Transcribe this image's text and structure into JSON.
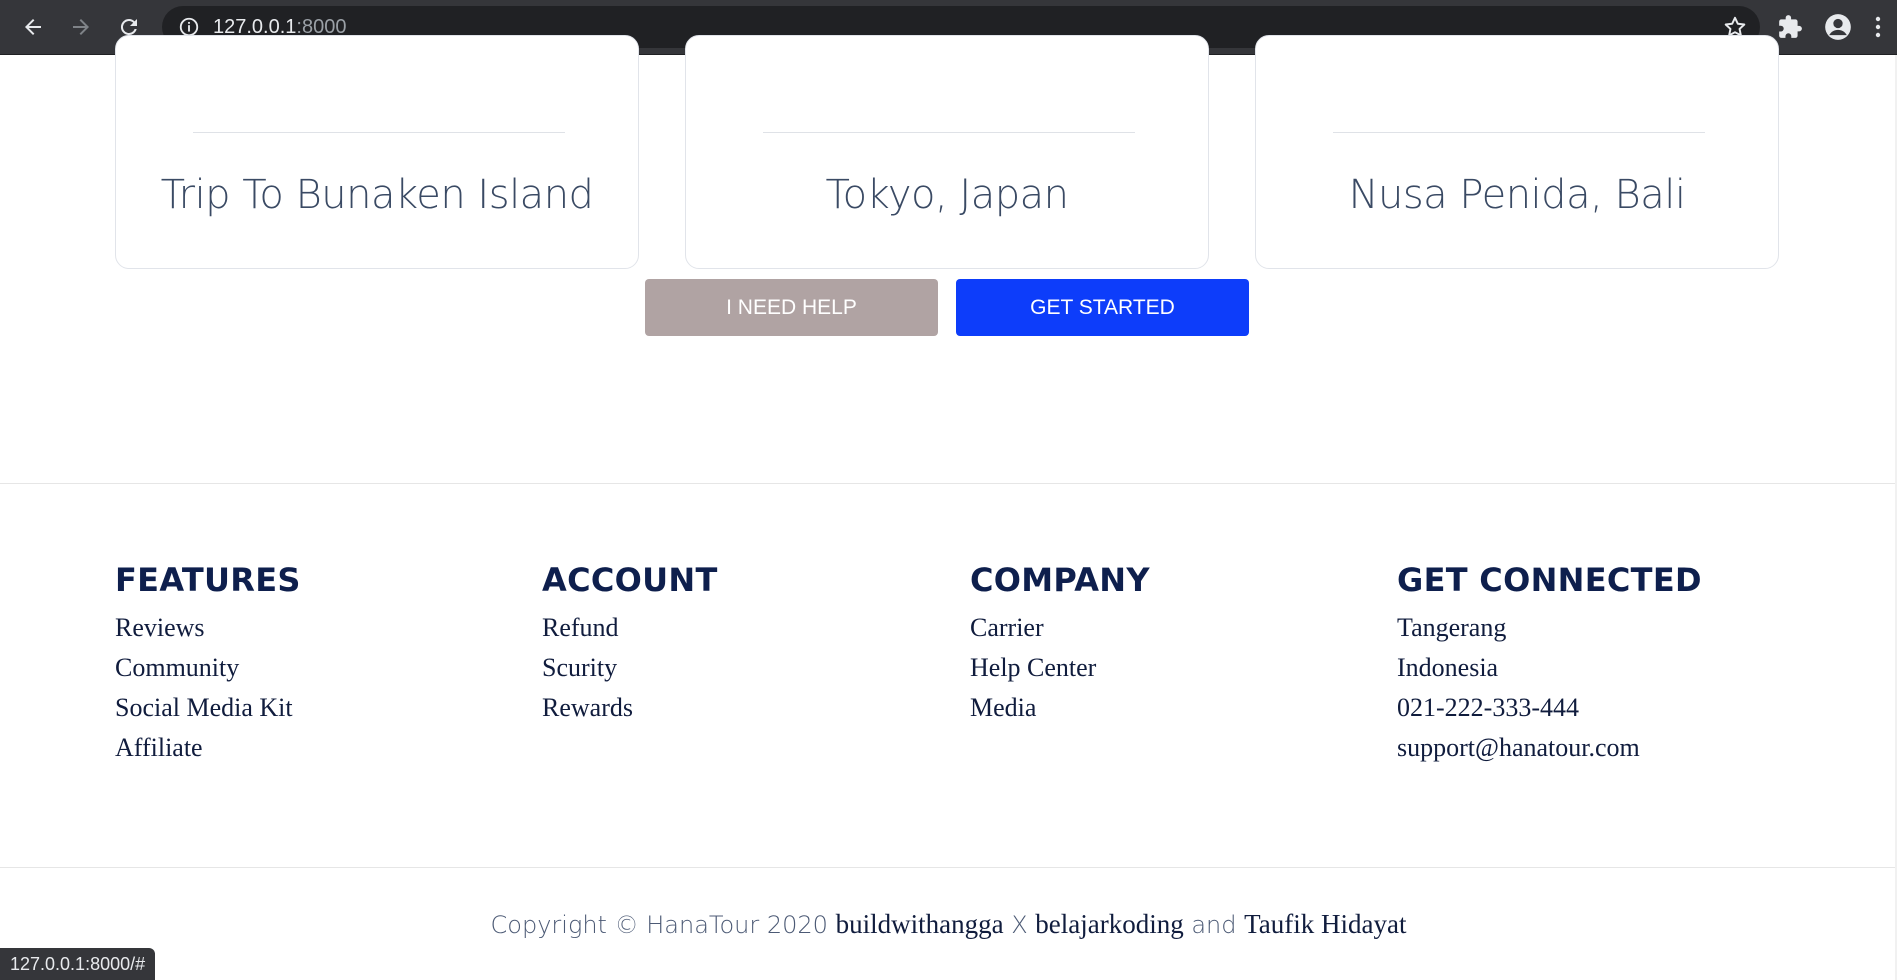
{
  "browser": {
    "url_host": "127.0.0.1",
    "url_port": ":8000",
    "status_text": "127.0.0.1:8000/#"
  },
  "cards": [
    {
      "title": "Trip To Bunaken Island"
    },
    {
      "title": "Tokyo, Japan"
    },
    {
      "title": "Nusa Penida, Bali"
    }
  ],
  "actions": {
    "help_label": "I NEED HELP",
    "start_label": "GET STARTED"
  },
  "footer": {
    "columns": [
      {
        "heading": "FEATURES",
        "items": [
          "Reviews",
          "Community",
          "Social Media Kit",
          "Affiliate"
        ]
      },
      {
        "heading": "ACCOUNT",
        "items": [
          "Refund",
          "Scurity",
          "Rewards"
        ]
      },
      {
        "heading": "COMPANY",
        "items": [
          "Carrier",
          "Help Center",
          "Media"
        ]
      },
      {
        "heading": "GET CONNECTED",
        "items": [
          "Tangerang",
          "Indonesia",
          "021-222-333-444",
          "support@hanatour.com"
        ]
      }
    ],
    "copyright": {
      "prefix": "Copyright © HanaTour 2020 ",
      "link1": "buildwithangga",
      "sep1": " X ",
      "link2": "belajarkoding",
      "sep2": " and ",
      "link3": "Taufik Hidayat"
    }
  },
  "colors": {
    "primary_button": "#0d3dfa",
    "secondary_button": "#b0a3a3",
    "heading_text": "#0e1f4d"
  }
}
